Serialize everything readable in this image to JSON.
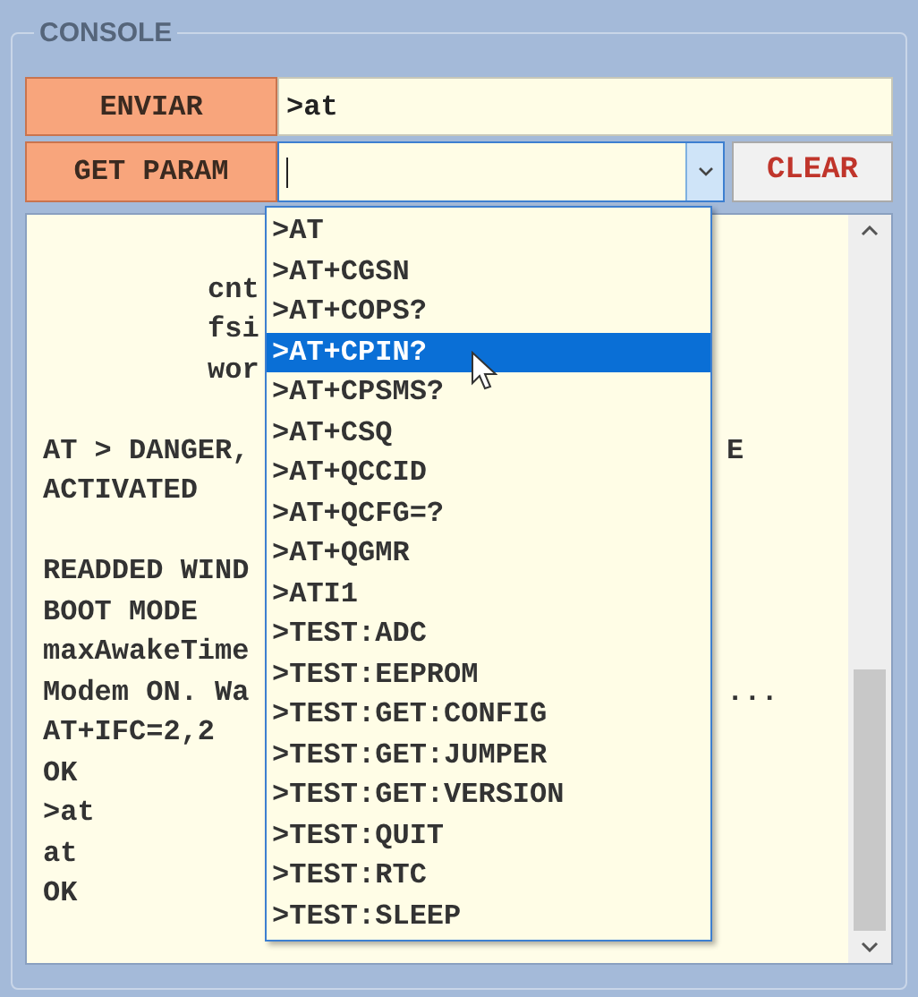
{
  "group": {
    "title": "CONSOLE"
  },
  "send_button": {
    "label": "ENVIAR"
  },
  "command_field": {
    "value": ">at"
  },
  "param_button": {
    "label": "GET PARAM"
  },
  "param_combo": {
    "expanded": true
  },
  "clear_button": {
    "label": "CLEAR"
  },
  "console_lines": [
    {
      "kind": "blank"
    },
    {
      "kind": "indented",
      "text": "cnt"
    },
    {
      "kind": "indented",
      "text": "fsi"
    },
    {
      "kind": "indented",
      "text": "wor"
    },
    {
      "kind": "blank"
    },
    {
      "kind": "text",
      "text": "AT > DANGER,",
      "tail": "E"
    },
    {
      "kind": "text",
      "text": "ACTIVATED"
    },
    {
      "kind": "blank"
    },
    {
      "kind": "text",
      "text": "READDED WIND"
    },
    {
      "kind": "text",
      "text": "BOOT MODE"
    },
    {
      "kind": "text",
      "text": "maxAwakeTime"
    },
    {
      "kind": "text",
      "text": "Modem ON. Wa",
      "tail": "..."
    },
    {
      "kind": "text",
      "text": "AT+IFC=2,2"
    },
    {
      "kind": "text",
      "text": "OK"
    },
    {
      "kind": "text",
      "text": ">at"
    },
    {
      "kind": "text",
      "text": "at"
    },
    {
      "kind": "text",
      "text": "OK"
    }
  ],
  "dropdown_items": [
    {
      "text": ">AT",
      "selected": false
    },
    {
      "text": ">AT+CGSN",
      "selected": false
    },
    {
      "text": ">AT+COPS?",
      "selected": false
    },
    {
      "text": ">AT+CPIN?",
      "selected": true
    },
    {
      "text": ">AT+CPSMS?",
      "selected": false
    },
    {
      "text": ">AT+CSQ",
      "selected": false
    },
    {
      "text": ">AT+QCCID",
      "selected": false
    },
    {
      "text": ">AT+QCFG=?",
      "selected": false
    },
    {
      "text": ">AT+QGMR",
      "selected": false
    },
    {
      "text": ">ATI1",
      "selected": false
    },
    {
      "text": ">TEST:ADC",
      "selected": false
    },
    {
      "text": ">TEST:EEPROM",
      "selected": false
    },
    {
      "text": ">TEST:GET:CONFIG",
      "selected": false
    },
    {
      "text": ">TEST:GET:JUMPER",
      "selected": false
    },
    {
      "text": ">TEST:GET:VERSION",
      "selected": false
    },
    {
      "text": ">TEST:QUIT",
      "selected": false
    },
    {
      "text": ">TEST:RTC",
      "selected": false
    },
    {
      "text": ">TEST:SLEEP",
      "selected": false
    }
  ]
}
